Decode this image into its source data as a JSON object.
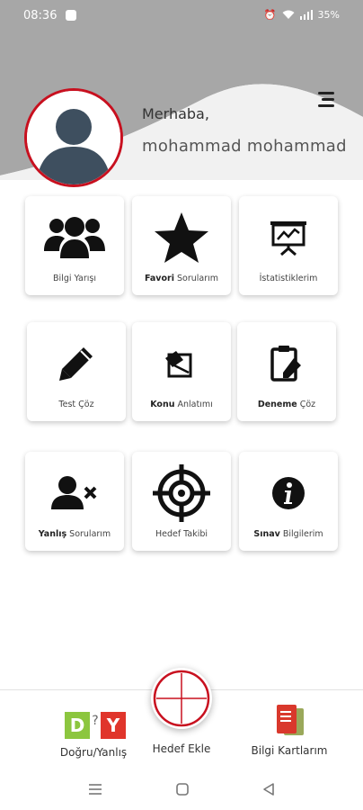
{
  "status_bar": {
    "time": "08:36",
    "battery": "35%"
  },
  "header": {
    "greeting": "Merhaba,",
    "username": "mohammad mohammad"
  },
  "grid": [
    {
      "bold": "",
      "rest": "Bilgi Yarışı",
      "icon": "users-icon"
    },
    {
      "bold": "Favori",
      "rest": " Sorularım",
      "icon": "star-icon"
    },
    {
      "bold": "",
      "rest": "İstatistiklerim",
      "icon": "presentation-chart-icon"
    },
    {
      "bold": "",
      "rest": "Test Çöz",
      "icon": "pencil-icon"
    },
    {
      "bold": "Konu",
      "rest": " Anlatımı",
      "icon": "book-edit-icon"
    },
    {
      "bold": "Deneme",
      "rest": " Çöz",
      "icon": "clipboard-edit-icon"
    },
    {
      "bold": "Yanlış",
      "rest": " Sorularım",
      "icon": "user-times-icon"
    },
    {
      "bold": "",
      "rest": "Hedef Takibi",
      "icon": "crosshair-icon"
    },
    {
      "bold": "Sınav",
      "rest": " Bilgilerim",
      "icon": "info-icon"
    }
  ],
  "bottom_nav": {
    "left_label": "Doğru/Yanlış",
    "center_label": "Hedef Ekle",
    "right_label": "Bilgi Kartlarım",
    "dy_badge": {
      "d": "D",
      "q": "?",
      "y": "Y"
    }
  },
  "colors": {
    "accent": "#c8101f",
    "header_gray": "#a7a7a7",
    "green": "#8cc63f",
    "red": "#e0352b"
  }
}
